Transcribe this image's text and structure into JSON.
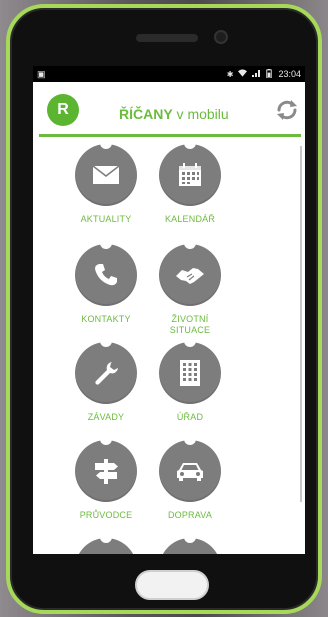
{
  "statusbar": {
    "time": "23:04"
  },
  "app": {
    "logo_letter": "R",
    "title_bold": "ŘÍČANY",
    "title_rest": " v mobilu"
  },
  "tiles": [
    {
      "label": "AKTUALITY",
      "icon": "envelope-icon"
    },
    {
      "label": "KALENDÁŘ",
      "icon": "calendar-icon"
    },
    {
      "label": "KONTAKTY",
      "icon": "phone-icon"
    },
    {
      "label": "ŽIVOTNÍ",
      "label2": "SITUACE",
      "icon": "handshake-icon"
    },
    {
      "label": "ZÁVADY",
      "icon": "wrench-icon"
    },
    {
      "label": "ÚŘAD",
      "icon": "building-icon"
    },
    {
      "label": "PRŮVODCE",
      "icon": "signpost-icon"
    },
    {
      "label": "DOPRAVA",
      "icon": "car-icon"
    }
  ],
  "colors": {
    "accent": "#6cbb3f",
    "tile": "#7d7d7d",
    "phone_frame": "#a6d85a"
  }
}
